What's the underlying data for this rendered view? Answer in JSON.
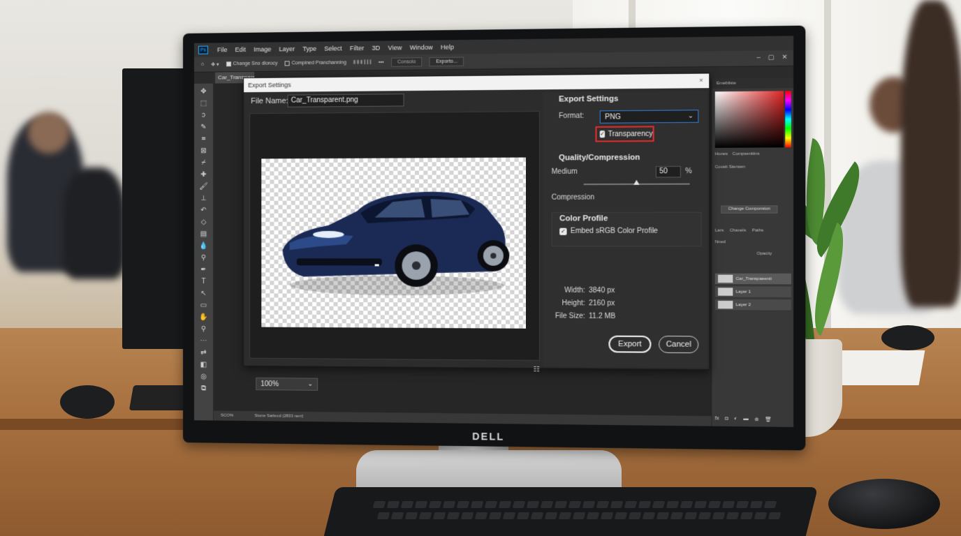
{
  "menubar": {
    "app_logo": "Ps",
    "items": [
      "File",
      "Edit",
      "Image",
      "Layer",
      "Type",
      "Select",
      "Filter",
      "3D",
      "View",
      "Window",
      "Help"
    ]
  },
  "options_bar": {
    "check1": "Change Sno dlorocy",
    "check2": "Compined Pranchanning",
    "btn1": "Consolo",
    "btn2": "Exporto..."
  },
  "document_tab": "Car_Transparent",
  "status_bar": {
    "zoom": "SCO%",
    "info": "Stone Sarlecd (2833 nerr)"
  },
  "right_panels": {
    "top_tab": "Emebliste",
    "tabs2": [
      "Hones",
      "Compsenitins"
    ],
    "label1": "Cousit Stensen",
    "button": "Change Componsion",
    "tabs3": [
      "Lars",
      "Chanels",
      "Paths"
    ],
    "blend": "Nned",
    "opacity": "Opacity",
    "layers": [
      "Car_Transpaeenti",
      "Layer 1",
      "Layer 2"
    ],
    "bottom_icons": [
      "fx",
      "mask",
      "adj",
      "folder",
      "new",
      "trash"
    ]
  },
  "dialog": {
    "title": "Export Settings",
    "close_icon": "×",
    "file_name_label": "File Name:",
    "file_name_value": "Car_Transparent.png",
    "zoom_value": "100%",
    "settings": {
      "heading": "Export Settings",
      "format_label": "Format:",
      "format_value": "PNG",
      "transparency_label": "Transparency",
      "transparency_checked": true
    },
    "quality": {
      "heading": "Quality/Compression",
      "level_label": "Medium",
      "value": "50",
      "unit": "%",
      "slider_fraction": 0.5,
      "compression_label": "Compression"
    },
    "color_profile": {
      "heading": "Color Profile",
      "embed_label": "Embed sRGB Color Profile",
      "embed_checked": true
    },
    "info": {
      "width_label": "Width:",
      "width_value": "3840 px",
      "height_label": "Height:",
      "height_value": "2160 px",
      "size_label": "File Size:",
      "size_value": "11.2 MB"
    },
    "export_button": "Export",
    "cancel_button": "Cancel"
  },
  "monitor_brand": "DELL",
  "colors": {
    "accent_blue": "#2f7dd6",
    "highlight_red": "#e02b2b",
    "car_body": "#1a2a55"
  }
}
